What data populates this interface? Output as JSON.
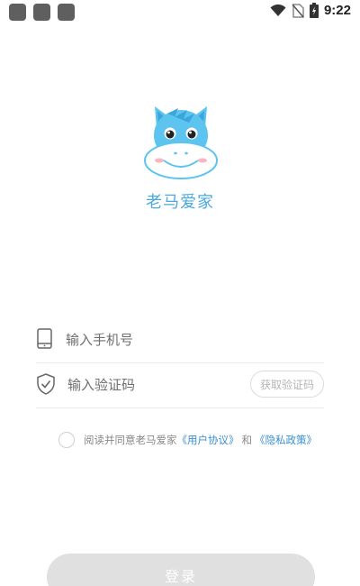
{
  "status_bar": {
    "time": "9:22",
    "icons": [
      "app-square-icon",
      "app-square-icon",
      "app-square-icon",
      "wifi-icon",
      "no-sim-icon",
      "battery-charging-icon"
    ]
  },
  "app": {
    "name": "老马爱家",
    "logo_icon": "horse-logo-icon",
    "brand_color": "#4aa9df"
  },
  "form": {
    "phone_placeholder": "输入手机号",
    "phone_icon": "phone-icon",
    "code_placeholder": "输入验证码",
    "code_icon": "shield-check-icon",
    "get_code_label": "获取验证码"
  },
  "agreement": {
    "prefix": "阅读并同意老马爱家",
    "user_agreement": "《用户协议》",
    "and": "和",
    "privacy_policy": "《隐私政策》",
    "link_color": "#3a8fd0"
  },
  "login": {
    "label": "登录"
  }
}
